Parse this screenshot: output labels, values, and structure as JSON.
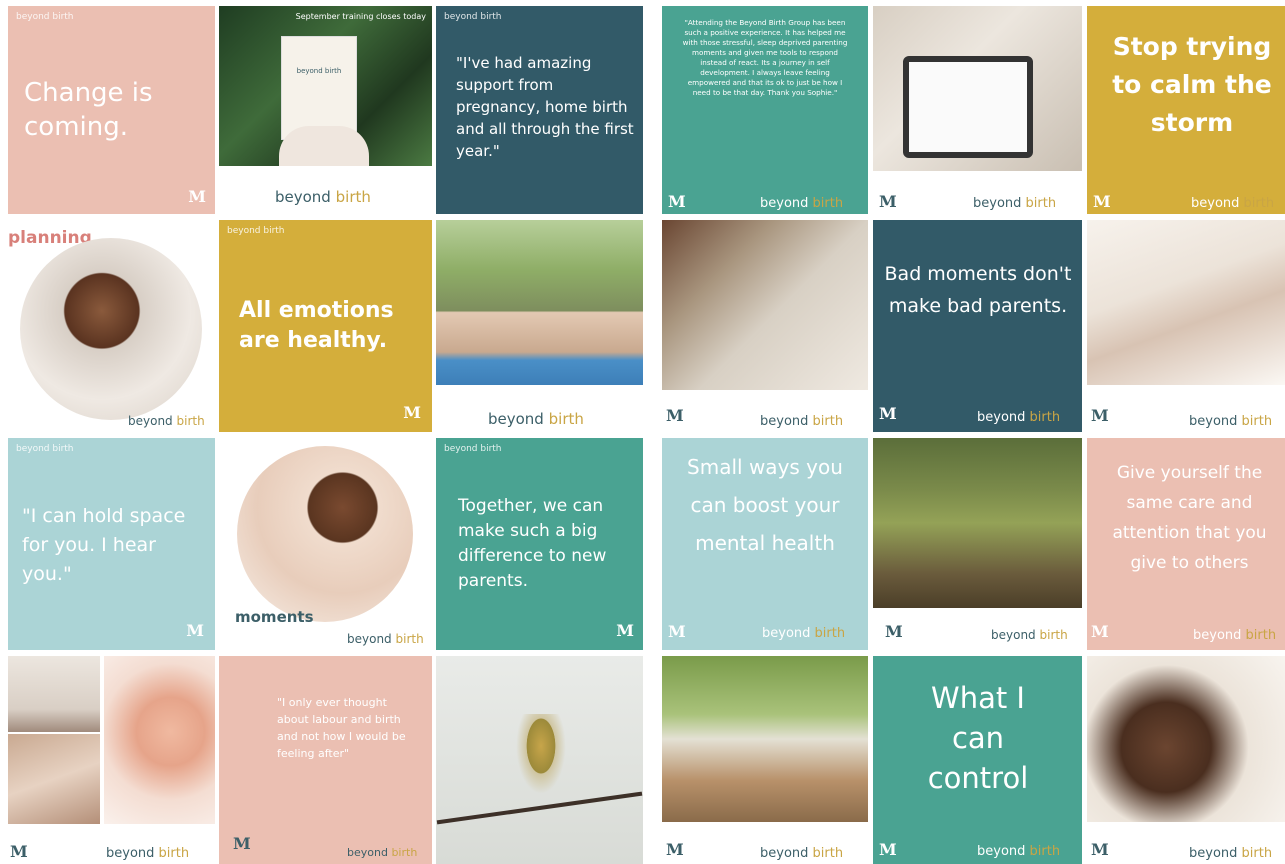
{
  "colors": {
    "peach": "#ebbfb2",
    "teal_dark": "#325a68",
    "mustard": "#d4ae3b",
    "light_blue": "#abd4d6",
    "teal_green": "#4aa392",
    "white": "#ffffff",
    "brand_text": "#3c5f68",
    "brand_accent": "#c9a545"
  },
  "brand": {
    "name_a": "beyond",
    "name_b": "birth",
    "monogram": "M",
    "small_label": "beyond birth"
  },
  "left_grid": {
    "t1_text": "Change is coming.",
    "t2_banner": "September training closes today",
    "t2_booklet": "beyond birth",
    "t3_quote": "\"I've had amazing support from pregnancy, home birth and all through the first year.\"",
    "t4_label": "planning",
    "t5_text": "All emotions are healthy.",
    "t7_quote": "\"I can hold space for you. I hear you.\"",
    "t8_label": "moments",
    "t9_text": "Together, we can make such a big difference to new parents.",
    "t11_quote": "\"I only ever thought about labour and birth and not how I would be feeling after\""
  },
  "right_grid": {
    "r1_quote": "\"Attending the Beyond Birth Group has been such a positive experience. It has helped me with those stressful, sleep deprived parenting moments and given me tools to respond instead of react. Its a journey in self development. I always leave feeling empowered and that its ok to just be how I need to be that day. Thank you Sophie.\"",
    "r3_text": "Stop trying to calm the storm",
    "r5_text": "Bad moments don't make bad parents.",
    "r7_text": "Small ways you can boost your mental health",
    "r9_text": "Give yourself the same care and attention that you give to others",
    "r11_text": "What I can control"
  }
}
